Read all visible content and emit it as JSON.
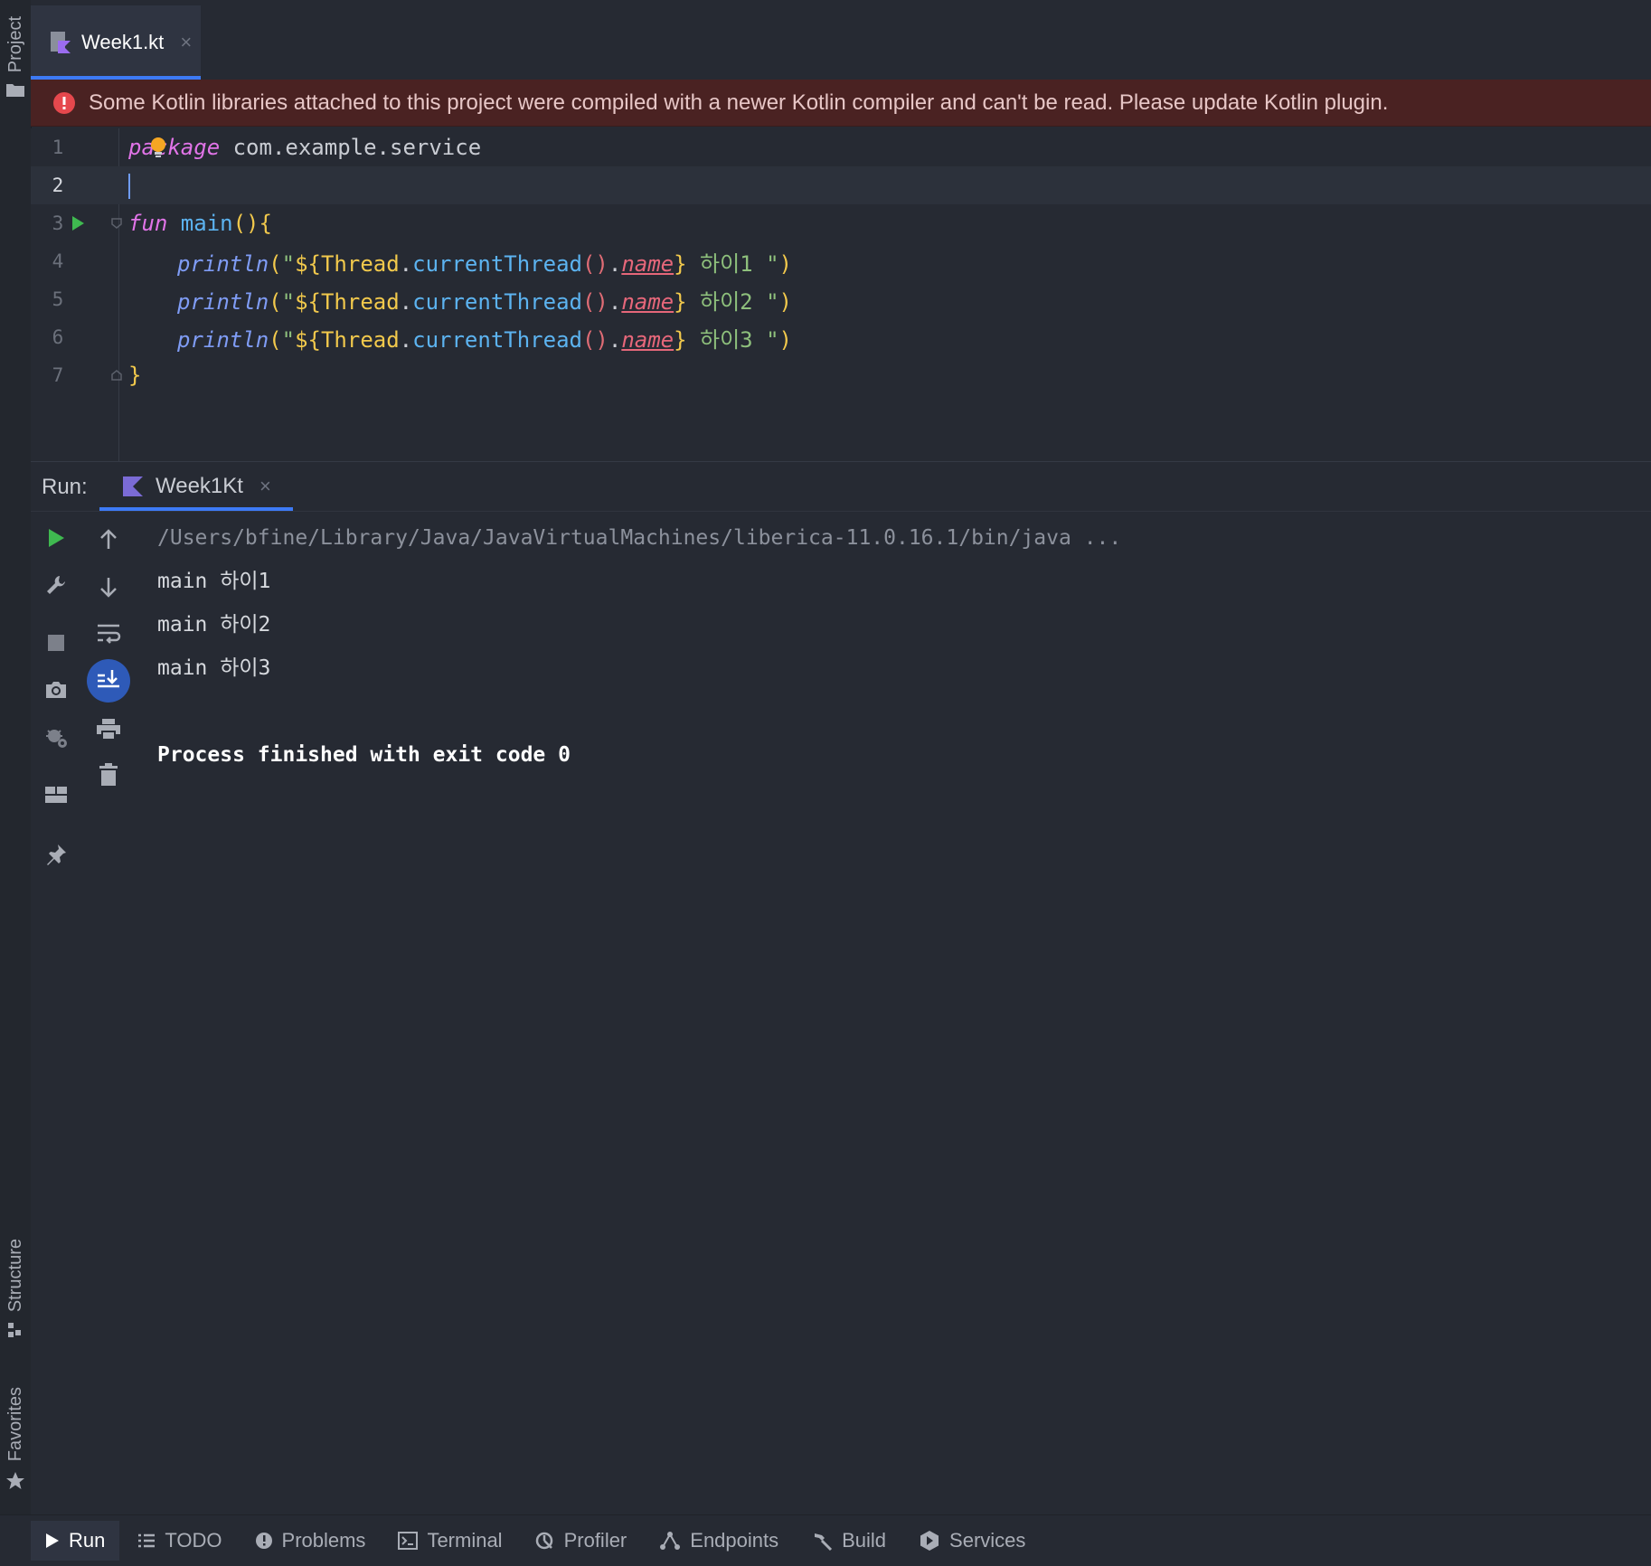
{
  "left_strip": {
    "project_label": "Project",
    "structure_label": "Structure",
    "favorites_label": "Favorites"
  },
  "editor_tab": {
    "label": "Week1.kt",
    "close": "×"
  },
  "banner": {
    "message": "Some Kotlin libraries attached to this project were compiled with a newer Kotlin compiler and can't be read. Please update Kotlin plugin."
  },
  "editor": {
    "line_numbers": [
      "1",
      "2",
      "3",
      "4",
      "5",
      "6",
      "7"
    ],
    "current_line": 2,
    "code": {
      "l1_kw": "package",
      "l1_rest": " com.example.service",
      "l3_kw": "fun",
      "l3_fn": " main",
      "l3_parens": "()",
      "l3_brace": "{",
      "println": "println",
      "paren_open": "(",
      "quote_dollar": "\"",
      "tmpl_open": "${",
      "cls": "Thread",
      "dot": ".",
      "method": "currentThread",
      "call_parens": "()",
      "prop": "name",
      "tmpl_close": "}",
      "str1": " 하이1 ",
      "str2": " 하이2 ",
      "str3": " 하이3 ",
      "quote_end": "\"",
      "paren_close": ")",
      "l7_brace": "}"
    }
  },
  "run_panel": {
    "run_label": "Run:",
    "tab_label": "Week1Kt",
    "tab_close": "×",
    "console": {
      "command": "/Users/bfine/Library/Java/JavaVirtualMachines/liberica-11.0.16.1/bin/java ...",
      "lines": [
        "main 하이1",
        "main 하이2",
        "main 하이3"
      ],
      "finish": "Process finished with exit code 0"
    }
  },
  "bottom_bar": {
    "tabs": [
      "Run",
      "TODO",
      "Problems",
      "Terminal",
      "Profiler",
      "Endpoints",
      "Build",
      "Services"
    ]
  },
  "colors": {
    "background": "#262a33",
    "banner": "#4a2222",
    "accent": "#3d7af5",
    "run_green": "#3fb950",
    "keyword": "#e174e8"
  }
}
